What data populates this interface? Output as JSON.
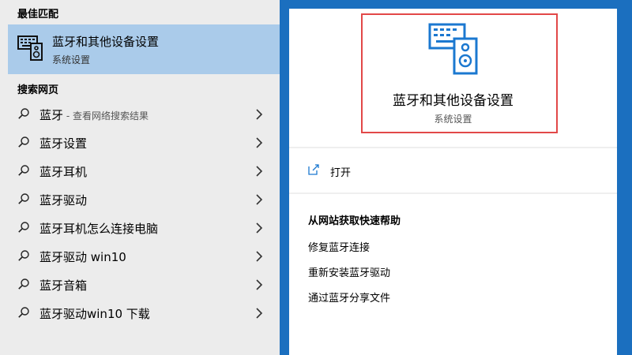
{
  "left_pane": {
    "best_match_heading": "最佳匹配",
    "best_match": {
      "icon": "bluetooth-devices-icon",
      "title": "蓝牙和其他设备设置",
      "subtitle": "系统设置"
    },
    "web_heading": "搜索网页",
    "search_items": [
      {
        "text": "蓝牙",
        "hint": " - 查看网络搜索结果"
      },
      {
        "text": "蓝牙设置",
        "hint": ""
      },
      {
        "text": "蓝牙耳机",
        "hint": ""
      },
      {
        "text": "蓝牙驱动",
        "hint": ""
      },
      {
        "text": "蓝牙耳机怎么连接电脑",
        "hint": ""
      },
      {
        "text": "蓝牙驱动 win10",
        "hint": ""
      },
      {
        "text": "蓝牙音箱",
        "hint": ""
      },
      {
        "text": "蓝牙驱动win10 下载",
        "hint": ""
      }
    ]
  },
  "right_pane": {
    "hero": {
      "icon": "bluetooth-devices-icon",
      "title": "蓝牙和其他设备设置",
      "subtitle": "系统设置"
    },
    "open_label": "打开",
    "help_heading": "从网站获取快速帮助",
    "help_links": [
      "修复蓝牙连接",
      "重新安装蓝牙驱动",
      "通过蓝牙分享文件"
    ]
  },
  "colors": {
    "selection": "#aacbea",
    "accent_icon": "#1b78d0",
    "highlight_border": "#e24848",
    "background": "#1b6fbf"
  }
}
